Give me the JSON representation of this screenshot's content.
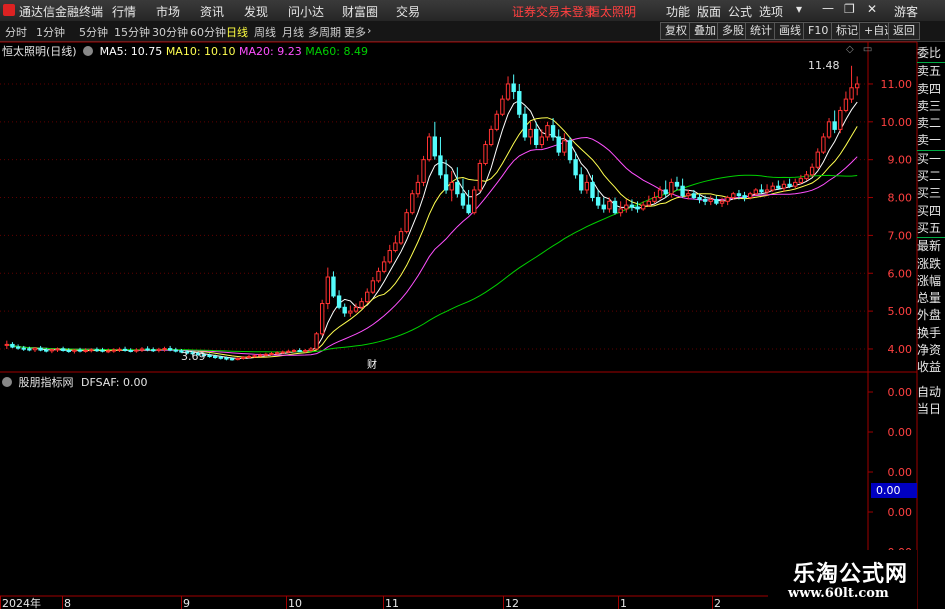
{
  "menu": {
    "app_title": "通达信金融终端",
    "items": [
      "行情",
      "市场",
      "资讯",
      "发现",
      "问小达",
      "财富圈",
      "交易"
    ],
    "notice": "证券交易未登录",
    "stock": "恒太照明",
    "right": [
      "功能",
      "版面",
      "公式",
      "选项"
    ],
    "user": "游客"
  },
  "toolbar": {
    "periods": [
      "分时",
      "1分钟",
      "5分钟",
      "15分钟",
      "30分钟",
      "60分钟",
      "日线",
      "周线",
      "月线",
      "多周期",
      "更多"
    ],
    "active_period": "日线",
    "right_buttons": [
      "复权",
      "叠加",
      "多股",
      "统计",
      "画线",
      "F10",
      "标记",
      "+自选",
      "返回"
    ]
  },
  "legend": {
    "title": "恒太照明(日线)",
    "ma5": "MA5: 10.75",
    "ma10": "MA10: 10.10",
    "ma20": "MA20: 9.23",
    "ma60": "MA60: 8.49"
  },
  "indicator": {
    "title": "股朋指标网",
    "value": "DFSAF: 0.00",
    "axis_labels": [
      "0.00",
      "0.00",
      "0.00",
      "0.00",
      "0.00"
    ],
    "current": "0.00"
  },
  "sidebar": [
    "委比",
    "卖五",
    "卖四",
    "卖三",
    "卖二",
    "卖一",
    "买一",
    "买二",
    "买三",
    "买四",
    "买五",
    "最新",
    "涨跌",
    "涨幅",
    "总量",
    "外盘",
    "换手",
    "净资",
    "收益",
    "自动",
    "当日"
  ],
  "watermark": {
    "line1": "乐淘公式网",
    "line2": "www.60lt.com"
  },
  "colors": {
    "up": "#ff3232",
    "down": "#54fcfc",
    "ma5": "#ffffff",
    "ma10": "#ffff50",
    "ma20": "#ff50ff",
    "ma60": "#00d000",
    "accent": "#ff4040"
  },
  "chart_data": {
    "type": "candlestick",
    "title": "恒太照明(日线)",
    "y_ticks": [
      4.0,
      5.0,
      6.0,
      7.0,
      8.0,
      9.0,
      10.0,
      11.0
    ],
    "ylim": [
      3.55,
      11.95
    ],
    "x_labels": [
      "2024年",
      "8",
      "9",
      "10",
      "11",
      "12",
      "1",
      "2"
    ],
    "annotations": {
      "high": "11.48",
      "low": "3.69",
      "event": "财"
    },
    "series": {
      "open": [
        4.1,
        4.12,
        4.05,
        4.02,
        4.0,
        3.98,
        4.02,
        3.97,
        3.95,
        3.98,
        4.0,
        3.96,
        3.94,
        3.97,
        3.95,
        3.96,
        3.98,
        3.97,
        3.94,
        3.95,
        3.97,
        3.99,
        3.96,
        3.95,
        3.97,
        4.0,
        3.98,
        3.96,
        3.99,
        4.01,
        3.97,
        3.95,
        3.92,
        3.9,
        3.88,
        3.85,
        3.83,
        3.8,
        3.78,
        3.76,
        3.74,
        3.72,
        3.75,
        3.78,
        3.8,
        3.82,
        3.84,
        3.86,
        3.88,
        3.9,
        3.92,
        3.94,
        3.96,
        3.93,
        3.96,
        4.0,
        4.4,
        5.2,
        5.9,
        5.4,
        5.1,
        4.95,
        5.0,
        5.1,
        5.25,
        5.5,
        5.8,
        6.05,
        6.3,
        6.6,
        6.8,
        7.1,
        7.6,
        8.1,
        8.4,
        9.0,
        9.6,
        9.1,
        8.6,
        8.2,
        8.4,
        8.1,
        7.8,
        7.6,
        8.2,
        8.9,
        9.4,
        9.8,
        10.2,
        10.6,
        11.0,
        10.8,
        10.2,
        9.6,
        9.8,
        9.4,
        9.6,
        9.9,
        9.6,
        9.2,
        9.5,
        9.0,
        8.6,
        8.2,
        8.4,
        8.0,
        7.8,
        7.7,
        7.9,
        7.6,
        7.7,
        7.8,
        7.75,
        7.7,
        7.8,
        7.9,
        8.0,
        8.2,
        8.1,
        8.4,
        8.3,
        8.05,
        8.1,
        8.0,
        7.95,
        7.9,
        7.95,
        7.85,
        7.9,
        8.0,
        8.1,
        8.05,
        8.0,
        8.1,
        8.2,
        8.15,
        8.2,
        8.3,
        8.25,
        8.35,
        8.3,
        8.4,
        8.5,
        8.6,
        8.8,
        9.2,
        9.6,
        10.0,
        9.8,
        10.3,
        10.6,
        10.9
      ],
      "high": [
        4.22,
        4.18,
        4.12,
        4.08,
        4.06,
        4.05,
        4.08,
        4.03,
        4.01,
        4.04,
        4.06,
        4.02,
        4.0,
        4.03,
        4.02,
        4.02,
        4.04,
        4.03,
        4.01,
        4.02,
        4.04,
        4.06,
        4.02,
        4.02,
        4.05,
        4.07,
        4.04,
        4.03,
        4.06,
        4.08,
        4.03,
        4.0,
        3.97,
        3.95,
        3.93,
        3.9,
        3.88,
        3.85,
        3.82,
        3.8,
        3.78,
        3.78,
        3.81,
        3.84,
        3.86,
        3.88,
        3.9,
        3.92,
        3.94,
        3.96,
        3.98,
        4.0,
        4.02,
        4.0,
        4.05,
        4.45,
        5.3,
        6.15,
        6.05,
        5.55,
        5.2,
        5.15,
        5.2,
        5.35,
        5.6,
        5.9,
        6.15,
        6.45,
        6.75,
        7.0,
        7.2,
        7.7,
        8.2,
        8.6,
        9.1,
        9.7,
        10.0,
        9.6,
        9.0,
        8.7,
        8.8,
        8.5,
        8.2,
        8.3,
        9.0,
        9.5,
        9.9,
        10.3,
        10.7,
        11.2,
        11.25,
        11.0,
        10.4,
        10.0,
        10.0,
        9.8,
        10.0,
        10.1,
        9.8,
        9.7,
        9.6,
        9.2,
        8.8,
        8.6,
        8.6,
        8.2,
        8.0,
        8.0,
        8.0,
        7.9,
        7.95,
        7.95,
        7.9,
        7.9,
        8.05,
        8.15,
        8.3,
        8.45,
        8.5,
        8.55,
        8.5,
        8.2,
        8.2,
        8.1,
        8.05,
        8.05,
        8.05,
        8.0,
        8.05,
        8.15,
        8.2,
        8.15,
        8.15,
        8.25,
        8.35,
        8.35,
        8.4,
        8.45,
        8.45,
        8.5,
        8.5,
        8.6,
        8.7,
        8.9,
        9.3,
        9.7,
        10.1,
        10.3,
        10.4,
        10.8,
        11.48,
        11.2
      ],
      "low": [
        4.0,
        4.02,
        3.98,
        3.95,
        3.94,
        3.92,
        3.94,
        3.91,
        3.89,
        3.92,
        3.93,
        3.9,
        3.88,
        3.91,
        3.9,
        3.91,
        3.92,
        3.91,
        3.89,
        3.9,
        3.92,
        3.93,
        3.91,
        3.9,
        3.92,
        3.94,
        3.92,
        3.91,
        3.93,
        3.94,
        3.91,
        3.89,
        3.86,
        3.84,
        3.82,
        3.79,
        3.77,
        3.74,
        3.72,
        3.7,
        3.69,
        3.7,
        3.72,
        3.75,
        3.77,
        3.79,
        3.81,
        3.83,
        3.85,
        3.87,
        3.89,
        3.91,
        3.92,
        3.9,
        3.93,
        3.98,
        4.35,
        5.05,
        5.35,
        5.05,
        4.85,
        4.85,
        4.95,
        5.05,
        5.2,
        5.45,
        5.75,
        6.0,
        6.25,
        6.55,
        6.75,
        7.05,
        7.55,
        8.0,
        8.3,
        8.95,
        9.0,
        8.5,
        8.1,
        7.9,
        8.0,
        7.7,
        7.55,
        7.55,
        8.15,
        8.85,
        9.35,
        9.75,
        10.15,
        10.55,
        10.6,
        10.1,
        9.5,
        9.4,
        9.3,
        9.3,
        9.5,
        9.5,
        9.1,
        9.1,
        8.9,
        8.5,
        8.1,
        8.1,
        7.9,
        7.7,
        7.6,
        7.6,
        7.55,
        7.5,
        7.6,
        7.65,
        7.6,
        7.65,
        7.75,
        7.85,
        7.95,
        8.0,
        8.0,
        8.2,
        8.0,
        7.95,
        7.95,
        7.85,
        7.8,
        7.8,
        7.8,
        7.75,
        7.8,
        7.95,
        7.95,
        7.9,
        7.95,
        8.05,
        8.1,
        8.05,
        8.15,
        8.2,
        8.15,
        8.25,
        8.25,
        8.35,
        8.45,
        8.55,
        8.75,
        9.15,
        9.55,
        9.7,
        9.7,
        10.25,
        10.5,
        10.7
      ],
      "close": [
        4.12,
        4.05,
        4.02,
        4.0,
        3.98,
        4.02,
        3.97,
        3.95,
        3.98,
        4.0,
        3.96,
        3.94,
        3.97,
        3.95,
        3.96,
        3.98,
        3.97,
        3.94,
        3.95,
        3.97,
        3.99,
        3.96,
        3.95,
        3.97,
        4.0,
        3.98,
        3.96,
        3.99,
        4.01,
        3.97,
        3.95,
        3.92,
        3.9,
        3.88,
        3.85,
        3.83,
        3.8,
        3.78,
        3.76,
        3.74,
        3.72,
        3.75,
        3.78,
        3.8,
        3.82,
        3.84,
        3.86,
        3.88,
        3.9,
        3.92,
        3.94,
        3.96,
        3.93,
        3.96,
        4.0,
        4.4,
        5.2,
        5.9,
        5.4,
        5.1,
        4.95,
        5.0,
        5.1,
        5.25,
        5.5,
        5.8,
        6.05,
        6.3,
        6.6,
        6.8,
        7.1,
        7.6,
        8.1,
        8.4,
        9.0,
        9.6,
        9.1,
        8.6,
        8.2,
        8.4,
        8.1,
        7.8,
        7.6,
        8.2,
        8.9,
        9.4,
        9.8,
        10.2,
        10.6,
        11.0,
        10.8,
        10.2,
        9.6,
        9.8,
        9.4,
        9.6,
        9.9,
        9.6,
        9.2,
        9.5,
        9.0,
        8.6,
        8.2,
        8.4,
        8.0,
        7.8,
        7.7,
        7.9,
        7.6,
        7.7,
        7.8,
        7.75,
        7.7,
        7.8,
        7.9,
        8.0,
        8.2,
        8.1,
        8.4,
        8.3,
        8.05,
        8.1,
        8.0,
        7.95,
        7.9,
        7.95,
        7.85,
        7.9,
        8.0,
        8.1,
        8.05,
        8.0,
        8.1,
        8.2,
        8.15,
        8.2,
        8.3,
        8.25,
        8.35,
        8.3,
        8.4,
        8.5,
        8.6,
        8.8,
        9.2,
        9.6,
        10.0,
        9.8,
        10.3,
        10.6,
        10.9,
        11.0
      ]
    },
    "ma_series": [
      {
        "name": "MA5",
        "period": 5
      },
      {
        "name": "MA10",
        "period": 10
      },
      {
        "name": "MA20",
        "period": 20
      },
      {
        "name": "MA60",
        "period": 60
      }
    ],
    "indicator_series": {
      "name": "DFSAF",
      "value": 0.0
    }
  }
}
